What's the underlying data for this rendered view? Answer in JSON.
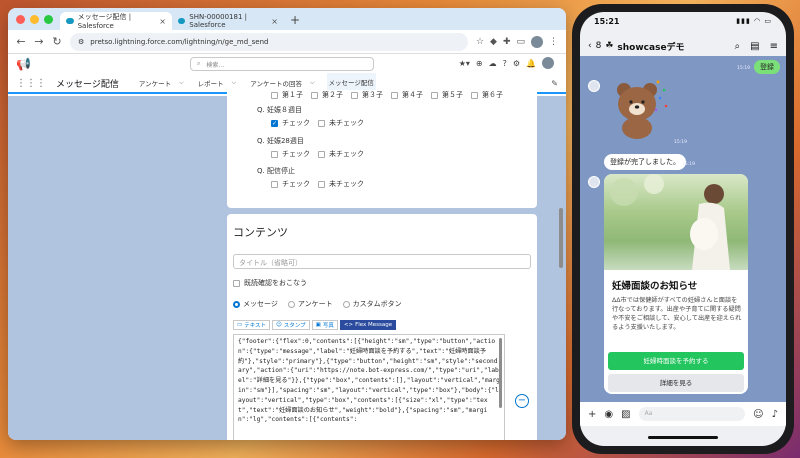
{
  "browser": {
    "tabs": [
      {
        "label": "メッセージ配信 | Salesforce",
        "active": true
      },
      {
        "label": "SHN-00000181 | Salesforce",
        "active": false
      }
    ],
    "new_tab": "+",
    "url": "pretso.lightning.force.com/lightning/n/ge_md_send",
    "search_placeholder": "検索..."
  },
  "sf": {
    "app_name": "メッセージ配信",
    "nav": [
      {
        "label": "アンケート",
        "active": false
      },
      {
        "label": "レポート",
        "active": false
      },
      {
        "label": "アンケートの回答",
        "active": false
      },
      {
        "label": "メッセージ配信",
        "active": true
      }
    ]
  },
  "questions": {
    "truncated_row": [
      "第１子",
      "第２子",
      "第３子",
      "第４子",
      "第５子",
      "第６子"
    ],
    "q1": {
      "label": "Q. 妊娠８週目",
      "opt1": "チェック",
      "opt2": "未チェック"
    },
    "q2": {
      "label": "Q. 妊娠28週目",
      "opt1": "チェック",
      "opt2": "未チェック"
    },
    "q3": {
      "label": "Q. 配信停止",
      "opt1": "チェック",
      "opt2": "未チェック"
    }
  },
  "contents": {
    "title": "コンテンツ",
    "title_placeholder": "タイトル（省略可）",
    "read_confirm": "既読確認をおこなう",
    "radio_message": "メッセージ",
    "radio_survey": "アンケート",
    "radio_custom": "カスタムボタン",
    "tab_text": "テキスト",
    "tab_stamp": "スタンプ",
    "tab_photo": "写真",
    "tab_flex": "Flex Message",
    "json": "{\"footer\":{\"flex\":0,\"contents\":[{\"height\":\"sm\",\"type\":\"button\",\"action\":{\"type\":\"message\",\"label\":\"妊婦時面談を予約する\",\"text\":\"妊婦時面談予約\"},\"style\":\"primary\"},{\"type\":\"button\",\"height\":\"sm\",\"style\":\"secondary\",\"action\":{\"uri\":\"https://note.bot-express.com/\",\"type\":\"uri\",\"label\":\"詳細を見る\"}},{\"type\":\"box\",\"contents\":[],\"layout\":\"vertical\",\"margin\":\"sm\"}],\"spacing\":\"sm\",\"layout\":\"vertical\",\"type\":\"box\"},\"body\":{\"layout\":\"vertical\",\"type\":\"box\",\"contents\":[{\"size\":\"xl\",\"type\":\"text\",\"text\":\"妊婦面談のお知らせ\",\"weight\":\"bold\"},{\"spacing\":\"sm\",\"margin\":\"lg\",\"contents\":[{\"contents\":"
  },
  "phone": {
    "time": "15:21",
    "back": "8",
    "chat_title": "showcaseデモ",
    "sent_msg": "登録",
    "ts1": "15:19",
    "ts2": "15:19",
    "ts3": "15:19",
    "done_msg": "登録が完了しました。",
    "flex_title": "妊婦面談のお知らせ",
    "flex_body": "ΔΔ市では保健師がすべての妊婦さんと面談を行なっております。出産や子育てに関する疑問や不安をご相談して、安心して出産を迎えられるよう支援いたします。",
    "btn_reserve": "妊婦時面談を予約する",
    "btn_detail": "詳細を見る",
    "input_placeholder": "Aa"
  },
  "colors": {
    "sf_blue": "#0176d3",
    "line_green": "#22c55e",
    "chat_bg": "#7e97c3"
  }
}
